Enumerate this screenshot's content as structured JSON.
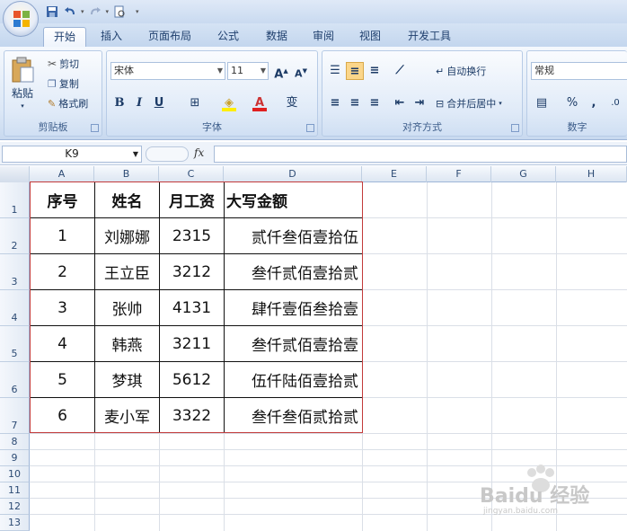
{
  "quick_access": {
    "save_icon": "save-icon",
    "undo_icon": "undo-icon",
    "redo_icon": "redo-icon",
    "preview_icon": "print-preview-icon",
    "customize_icon": "customize-qat-icon"
  },
  "tabs": [
    "开始",
    "插入",
    "页面布局",
    "公式",
    "数据",
    "审阅",
    "视图",
    "开发工具"
  ],
  "ribbon": {
    "clipboard": {
      "paste": "粘贴",
      "cut": "剪切",
      "copy": "复制",
      "format_painter": "格式刷",
      "label": "剪贴板"
    },
    "font": {
      "name": "宋体",
      "size": "11",
      "bold": "B",
      "italic": "I",
      "underline": "U",
      "grow": "A",
      "shrink": "A",
      "phonetic": "变",
      "font_color_glyph": "A",
      "label": "字体"
    },
    "alignment": {
      "wrap": "自动换行",
      "merge": "合并后居中",
      "label": "对齐方式"
    },
    "number": {
      "format": "常规",
      "percent": "%",
      "comma": ",",
      "label": "数字"
    }
  },
  "formula_bar": {
    "name_box": "K9",
    "fx": "fx",
    "formula": ""
  },
  "columns": [
    "A",
    "B",
    "C",
    "D",
    "E",
    "F",
    "G",
    "H"
  ],
  "rows": [
    "1",
    "2",
    "3",
    "4",
    "5",
    "6",
    "7",
    "8",
    "9",
    "10",
    "11",
    "12",
    "13"
  ],
  "table": {
    "headers": [
      "序号",
      "姓名",
      "月工资",
      "大写金额"
    ],
    "rows": [
      [
        "1",
        "刘娜娜",
        "2315",
        "贰仟叁佰壹拾伍"
      ],
      [
        "2",
        "王立臣",
        "3212",
        "叁仟贰佰壹拾贰"
      ],
      [
        "3",
        "张帅",
        "4131",
        "肆仟壹佰叁拾壹"
      ],
      [
        "4",
        "韩燕",
        "3211",
        "叁仟贰佰壹拾壹"
      ],
      [
        "5",
        "梦琪",
        "5612",
        "伍仟陆佰壹拾贰"
      ],
      [
        "6",
        "麦小军",
        "3322",
        "叁仟叁佰贰拾贰"
      ]
    ]
  },
  "watermark": {
    "text": "Baidu 经验",
    "sub": "jingyan.baidu.com"
  },
  "colors": {
    "accent": "#c23a3a",
    "ribbon": "#dbe7f6",
    "header_text": "#2d4b74"
  }
}
